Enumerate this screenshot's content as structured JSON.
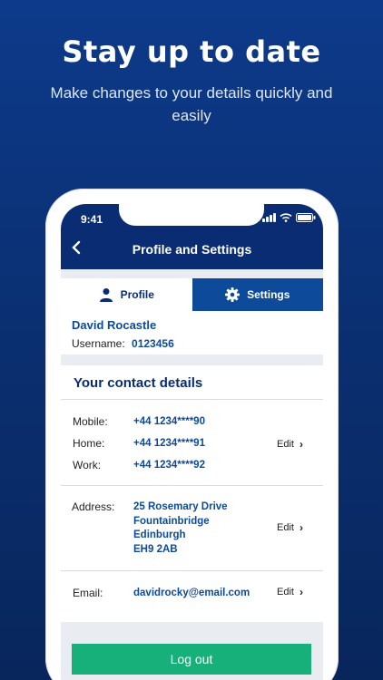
{
  "hero": {
    "title": "Stay up to date",
    "subtitle": "Make changes to your details quickly and easily"
  },
  "status_bar": {
    "time": "9:41"
  },
  "nav": {
    "back_icon": "chevron-left-icon",
    "title": "Profile and Settings"
  },
  "tabs": [
    {
      "label": "Profile",
      "icon": "person-icon",
      "active": true
    },
    {
      "label": "Settings",
      "icon": "gear-icon",
      "active": false
    }
  ],
  "user": {
    "name": "David Rocastle",
    "username_label": "Username:",
    "username_value": "0123456"
  },
  "contact": {
    "section_title": "Your contact details",
    "phones": [
      {
        "label": "Mobile:",
        "value": "+44 1234****90"
      },
      {
        "label": "Home:",
        "value": "+44 1234****91"
      },
      {
        "label": "Work:",
        "value": "+44 1234****92"
      }
    ],
    "phones_edit": "Edit",
    "address_label": "Address:",
    "address_lines": [
      "25 Rosemary Drive",
      "Fountainbridge",
      "Edinburgh",
      "EH9 2AB"
    ],
    "address_edit": "Edit",
    "email_label": "Email:",
    "email_value": "davidrocky@email.com",
    "email_edit": "Edit"
  },
  "logout": {
    "label": "Log out"
  },
  "colors": {
    "navy": "#0a2c73",
    "blue": "#0d4a99",
    "green": "#17b07a",
    "background": "#0d3a8a"
  }
}
